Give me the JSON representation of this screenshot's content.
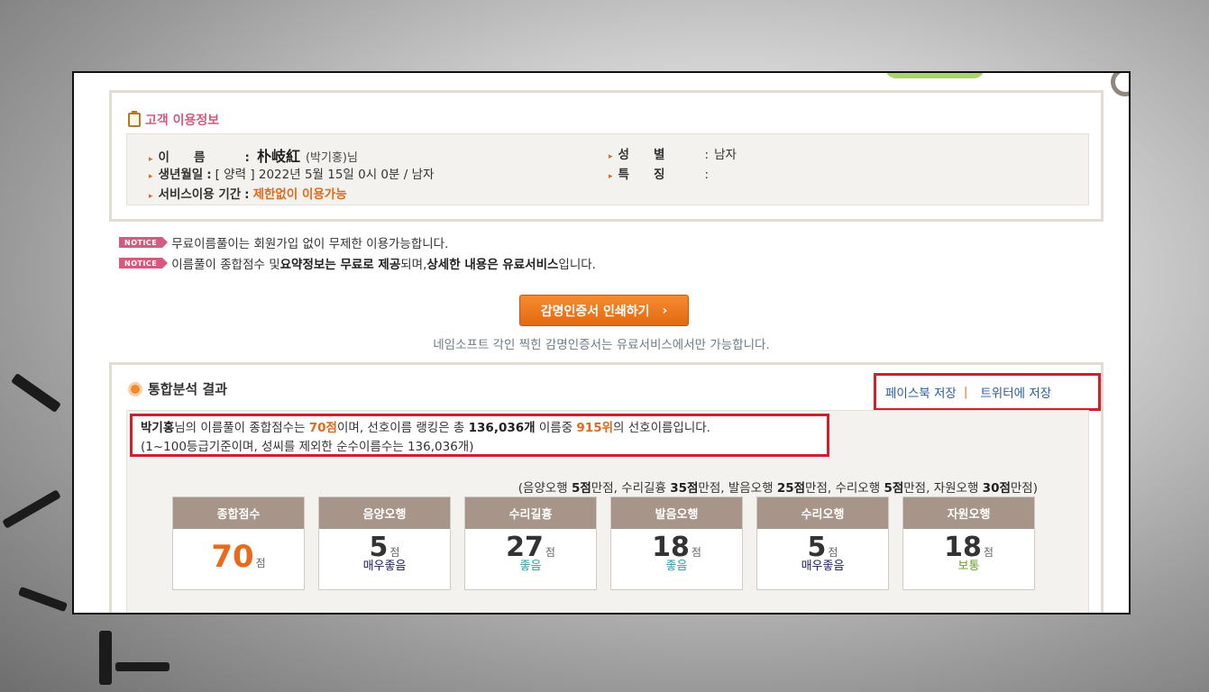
{
  "customer_info": {
    "title": "고객 이용정보",
    "name_label": "이　　름",
    "name_hanja": "朴岐紅",
    "name_hangul": "(박기홍)님",
    "birth_label": "생년월일",
    "birth_value": "[ 양력 ] 2022년 5월 15일 0시 0분 / 남자",
    "period_label": "서비스이용 기간",
    "period_value": "제한없이 이용가능",
    "gender_label": "성　　별",
    "gender_value": "남자",
    "feature_label": "특　　징",
    "feature_value": "",
    "colon": ":"
  },
  "notices": {
    "badge": "NOTICE",
    "line1": "무료이름풀이는 회원가입 없이 무제한 이용가능합니다.",
    "line2_a": "이름풀이 종합점수 및 ",
    "line2_b": "요약정보는 무료로 제공",
    "line2_c": "되며, ",
    "line2_d": "상세한 내용은 유료서비스",
    "line2_e": "입니다."
  },
  "print": {
    "button_label": "감명인증서 인쇄하기",
    "note": "네임소프트 각인 찍힌 감명인증서는 유료서비스에서만 가능합니다."
  },
  "result": {
    "title": "통합분석 결과",
    "share_facebook": "페이스북 저장",
    "share_sep": "|",
    "share_twitter": "트위터에 저장",
    "summary_name": "박기홍",
    "summary_t1": "님의 이름풀이 종합점수는 ",
    "summary_score": "70점",
    "summary_t2": "이며, 선호이름 랭킹은 총 ",
    "summary_total": "136,036개",
    "summary_t3": " 이름중 ",
    "summary_rank": "915위",
    "summary_t4": "의 선호이름입니다.",
    "summary_line2": "(1~100등급기준이며, 성씨를 제외한 순수이름수는 136,036개)",
    "legend_open": "(음양오행 ",
    "legend_1": "5점",
    "legend_t1": "만점, 수리길흉 ",
    "legend_2": "35점",
    "legend_t2": "만점, 발음오행 ",
    "legend_3": "25점",
    "legend_t3": "만점, 수리오행 ",
    "legend_4": "5점",
    "legend_t4": "만점, 자원오행 ",
    "legend_5": "30점",
    "legend_close": "만점)",
    "cards": [
      {
        "title": "종합점수",
        "score": "70",
        "unit": "점",
        "grade": "",
        "grade_color": ""
      },
      {
        "title": "음양오행",
        "score": "5",
        "unit": "점",
        "grade": "매우좋음",
        "grade_color": "#1a1a5a"
      },
      {
        "title": "수리길흉",
        "score": "27",
        "unit": "점",
        "grade": "좋음",
        "grade_color": "#2a9aa6"
      },
      {
        "title": "발음오행",
        "score": "18",
        "unit": "점",
        "grade": "좋음",
        "grade_color": "#2a9aa6"
      },
      {
        "title": "수리오행",
        "score": "5",
        "unit": "점",
        "grade": "매우좋음",
        "grade_color": "#1a1a5a"
      },
      {
        "title": "자원오행",
        "score": "18",
        "unit": "점",
        "grade": "보통",
        "grade_color": "#6a9a2a"
      }
    ]
  },
  "colors": {
    "accent_orange": "#e86a1c",
    "highlight_red": "#d0202e",
    "card_header": "#a69588",
    "notice_pink": "#d65a7e"
  }
}
